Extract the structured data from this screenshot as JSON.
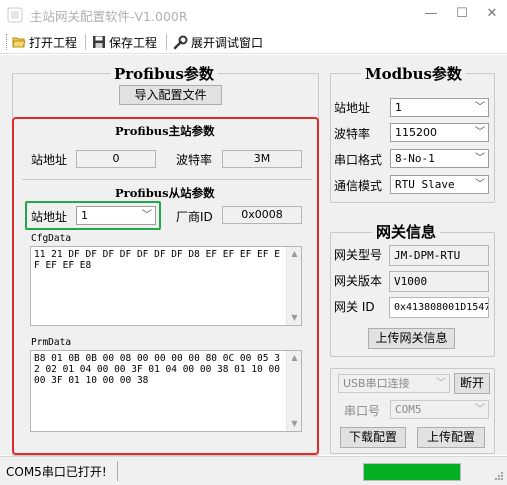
{
  "window": {
    "title": "主站网关配置软件-V1.000R",
    "controls": [
      "—",
      "☐",
      "✕"
    ]
  },
  "toolbar": {
    "open_label": "打开工程",
    "save_label": "保存工程",
    "debug_label": "展开调试窗口"
  },
  "profibus": {
    "group_title": "Profibus参数",
    "import_button": "导入配置文件",
    "master": {
      "title": "Profibus主站参数",
      "station_label": "站地址",
      "station_value": "0",
      "baud_label": "波特率",
      "baud_value": "3M"
    },
    "slave": {
      "title": "Profibus从站参数",
      "station_label": "站地址",
      "station_value": "1",
      "vendor_label": "厂商ID",
      "vendor_value": "0x0008",
      "cfg_label": "CfgData",
      "cfg_text": "11 21 DF DF DF DF DF DF DF D8 EF EF EF EF EF EF EF E8",
      "prm_label": "PrmData",
      "prm_text": "B8 01 0B 0B 00 08 00 00 00 00 80 0C 00 05 32 02 01 04 00 00 3F 01 04 00 00 38 01 10 00 00 3F 01 10 00 00 38"
    }
  },
  "modbus": {
    "group_title": "Modbus参数",
    "station_label": "站地址",
    "station_value": "1",
    "baud_label": "波特率",
    "baud_value": "115200",
    "format_label": "串口格式",
    "format_value": "8-No-1",
    "mode_label": "通信模式",
    "mode_value": "RTU Slave"
  },
  "gateway": {
    "group_title": "网关信息",
    "model_label": "网关型号",
    "model_value": "JM-DPM-RTU",
    "version_label": "网关版本",
    "version_value": "V1000",
    "id_label": "网关 ID",
    "id_value": "0x413808001D1547",
    "upload_button": "上传网关信息"
  },
  "connection": {
    "port_type_value": "USB串口连接",
    "disconnect_button": "断开",
    "port_label": "串口号",
    "port_value": "COM5",
    "download_button": "下载配置",
    "upload_button": "上传配置"
  },
  "status": {
    "text": "COM5串口已打开!",
    "progress": 1.0,
    "progress_color": "#06b025"
  },
  "colors": {
    "highlight_red": "#e22a2a",
    "highlight_green": "#22a84a"
  }
}
